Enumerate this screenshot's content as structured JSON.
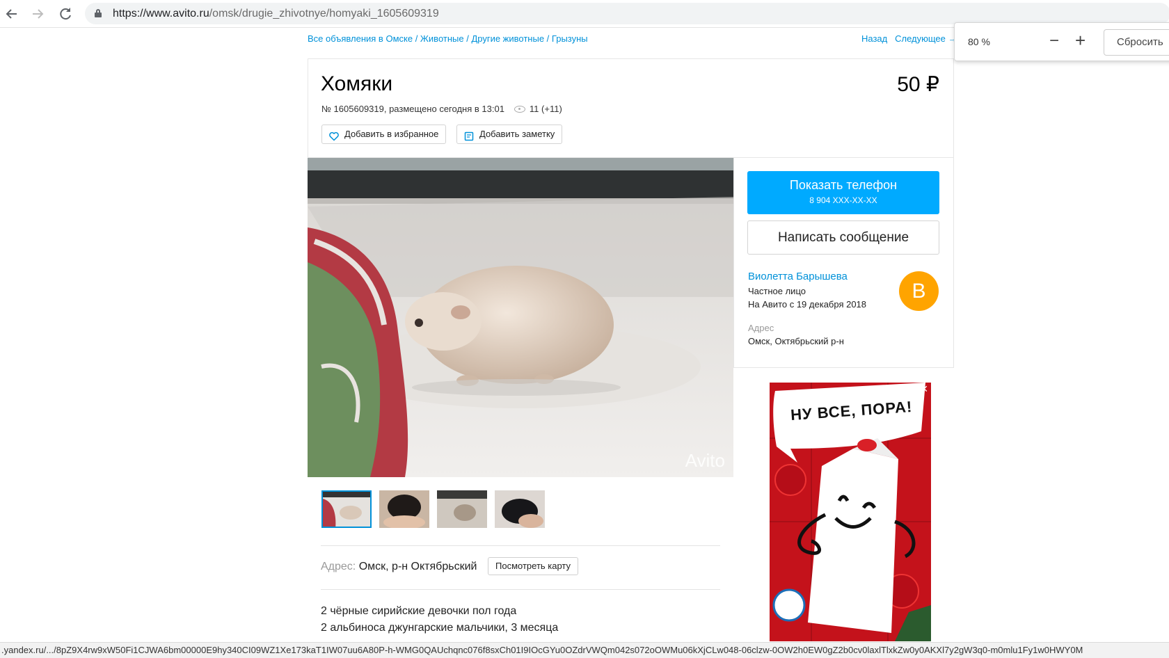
{
  "browser": {
    "url_host": "https://www.avito.ru",
    "url_path": "/omsk/drugie_zhivotnye/homyaki_1605609319"
  },
  "breadcrumbs": {
    "items": [
      "Все объявления в Омске",
      "Животные",
      "Другие животные",
      "Грызуны"
    ],
    "separator": " / "
  },
  "nav": {
    "back": "Назад",
    "next": "Следующее →"
  },
  "listing": {
    "title": "Хомяки",
    "price": "50 ₽",
    "meta": "№ 1605609319, размещено сегодня в 13:01",
    "views": "11 (+11)",
    "favorite_label": "Добавить в избранное",
    "note_label": "Добавить заметку",
    "watermark": "Avito",
    "address_label": "Адрес:",
    "address_value": "Омск, р-н Октябрьский",
    "map_button": "Посмотреть карту",
    "description": [
      "2 чёрные сирийские девочки пол года",
      "2 альбиноса джунгарские мальчики, 3 месяца"
    ]
  },
  "contact": {
    "show_phone": "Показать телефон",
    "phone_masked": "8 904 XXX-XX-XX",
    "write_message": "Написать сообщение"
  },
  "seller": {
    "name": "Виолетта Барышева",
    "type": "Частное лицо",
    "since": "На Авито с 19 декабря 2018",
    "avatar_letter": "В",
    "address_label": "Адрес",
    "address": "Омск, Октябрьский р-н"
  },
  "ad": {
    "headline": "НУ ВСЕ, ПОРА!",
    "close": "✕"
  },
  "zoom": {
    "value": "80 %",
    "minus": "−",
    "plus": "+",
    "reset": "Сбросить"
  },
  "status_bar": {
    "text": ".yandex.ru/.../8pZ9X4rw9xW50Fi1CJWA6bm00000E9hy340CI09WZ1Xe173kaT1IW07uu6A80P-h-WMG0QAUchqnc076f8sxCh01I9IOcGYu0OZdrVWQm042s072oOWMu06kXjCLw048-06clzw-0OW2h0EW0gZ2b0cv0laxlTlxkZw0y0AKXl7y2gW3q0-m0mlu1Fy1w0HWY0M"
  },
  "icons": {
    "back": "arrow-left-icon",
    "forward": "arrow-right-icon",
    "reload": "reload-icon",
    "lock": "lock-icon",
    "favorite": "heart-icon",
    "note": "note-icon",
    "views": "eye-icon"
  }
}
